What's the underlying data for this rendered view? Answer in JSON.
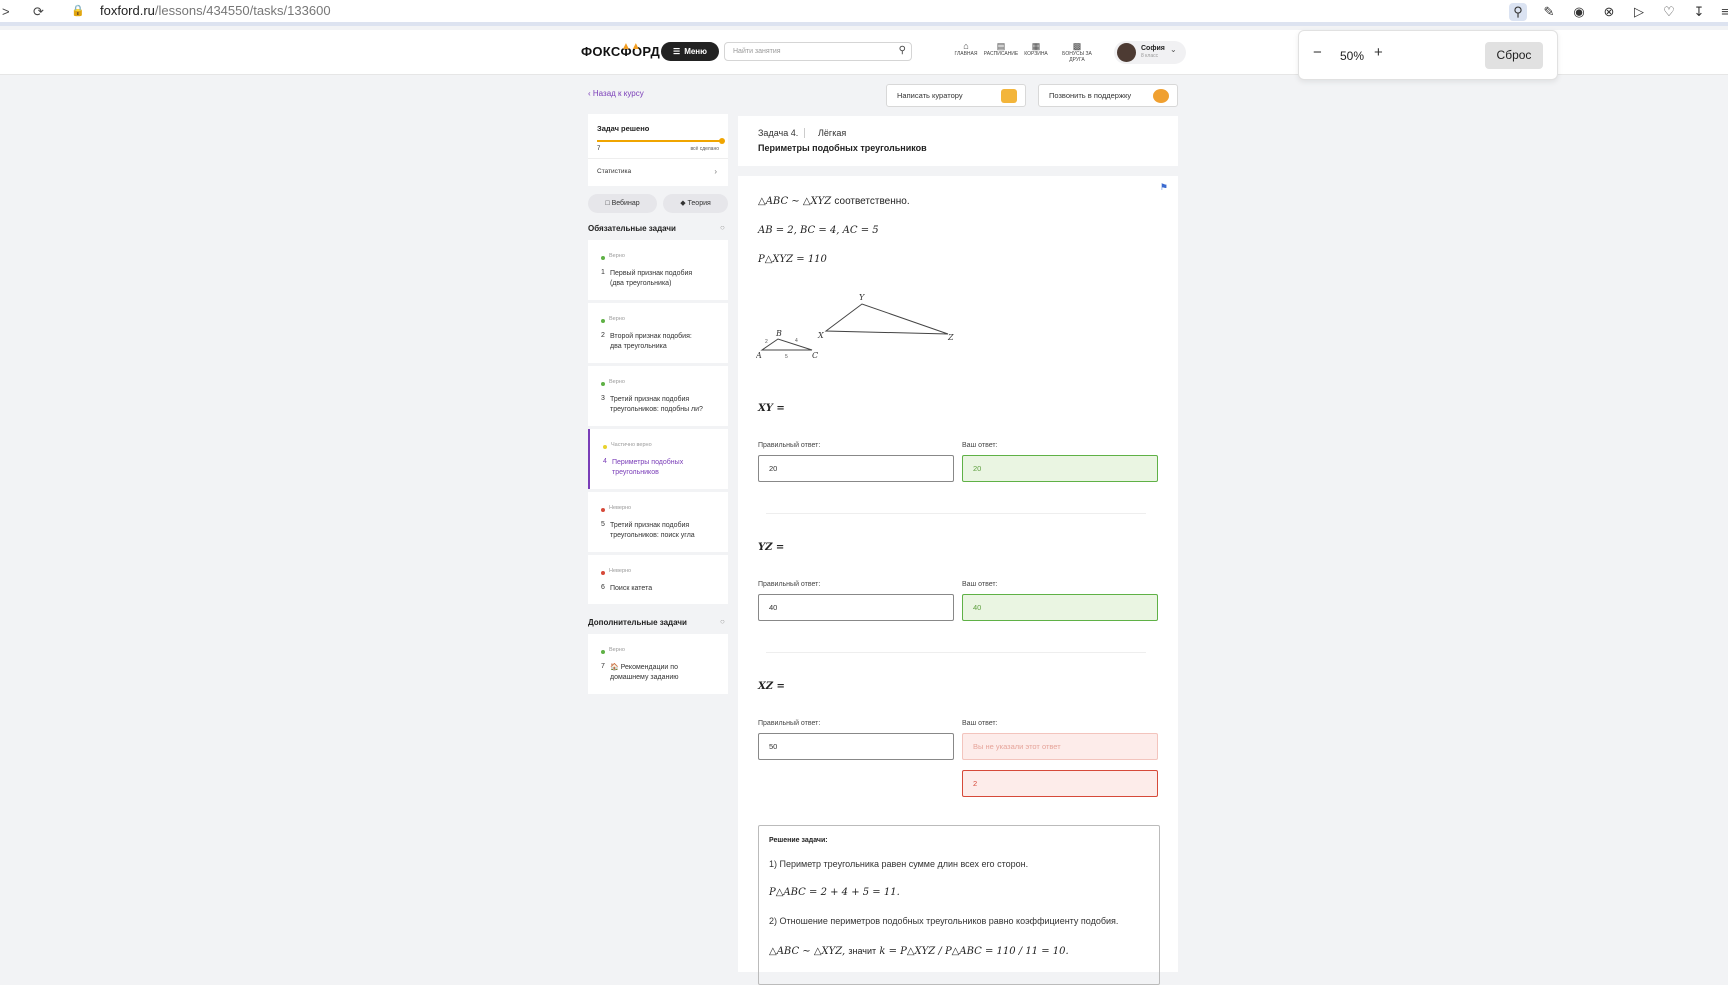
{
  "browser": {
    "url_domain": "foxford.ru",
    "url_path": "/lessons/434550/tasks/133600"
  },
  "site": {
    "logo": "ФОКСФОРД",
    "menu_label": "Меню",
    "search_placeholder": "Найти занятия",
    "nav": [
      "ГЛАВНАЯ",
      "РАСПИСАНИЕ",
      "КОРЗИНА",
      "БОНУСЫ ЗА ДРУГА"
    ],
    "user_name": "София",
    "user_grade": "8 класс"
  },
  "zoom": {
    "value": "50%",
    "reset_label": "Сброс"
  },
  "back_link": "Назад к курсу",
  "actions": {
    "write_curator": "Написать куратору",
    "call_support": "Позвонить в поддержку"
  },
  "progress": {
    "title": "Задач решено",
    "count": "7",
    "note": "всё сделано",
    "level": 1.0,
    "stats_label": "Статистика"
  },
  "pills": {
    "webinar": "Вебинар",
    "theory": "Теория"
  },
  "mandatory_header": "Обязательные задачи",
  "tasks": [
    {
      "status": "Верно",
      "num": "1",
      "line1": "Первый признак подобия",
      "line2": "(два треугольника)",
      "color": "#5fb146"
    },
    {
      "status": "Верно",
      "num": "2",
      "line1": "Второй признак подобия:",
      "line2": "два треугольника",
      "color": "#5fb146"
    },
    {
      "status": "Верно",
      "num": "3",
      "line1": "Третий признак подобия",
      "line2": "треугольников: подобны ли?",
      "color": "#5fb146"
    },
    {
      "status": "Частично верно",
      "num": "4",
      "line1": "Периметры подобных",
      "line2": "треугольников",
      "color": "#e8d22e"
    },
    {
      "status": "Неверно",
      "num": "5",
      "line1": "Третий признак подобия",
      "line2": "треугольников: поиск угла",
      "color": "#d64a3a"
    },
    {
      "status": "Неверно",
      "num": "6",
      "line1": "Поиск катета",
      "line2": "",
      "color": "#d64a3a"
    }
  ],
  "extra_header": "Дополнительные задачи",
  "extra_task": {
    "status": "Верно",
    "num": "7",
    "line1": "Рекомендации по",
    "line2": "домашнему заданию",
    "color": "#5fb146"
  },
  "task_header": {
    "label": "Задача 4.",
    "difficulty": "Лёгкая",
    "title": "Периметры подобных треугольников"
  },
  "problem": {
    "line1_math": "△ABC ∼ △XYZ",
    "line1_text": "соответственно.",
    "line2_math": "AB = 2, BC = 4, AC = 5",
    "line3_math": "P△XYZ = 110",
    "figure_labels": {
      "A": "A",
      "B": "B",
      "C": "C",
      "X": "X",
      "Y": "Y",
      "Z": "Z",
      "ab": "2",
      "bc": "4",
      "ac": "5"
    }
  },
  "questions": [
    {
      "label": "XY =",
      "correct_label": "Правильный ответ:",
      "your_label": "Ваш ответ:",
      "correct": "20",
      "yours": "20"
    },
    {
      "label": "YZ =",
      "correct_label": "Правильный ответ:",
      "your_label": "Ваш ответ:",
      "correct": "40",
      "yours": "40"
    },
    {
      "label": "XZ =",
      "correct_label": "Правильный ответ:",
      "your_label": "Ваш ответ:",
      "correct": "50",
      "missing": "Вы не указали этот ответ",
      "yours": "2"
    }
  ],
  "solution": {
    "title": "Решение задачи:",
    "step1": "1) Периметр треугольника равен сумме длин всех его сторон.",
    "step1_math": "P△ABC = 2 + 4 + 5 = 11.",
    "step2": "2) Отношение периметров подобных треугольников равно коэффициенту подобия.",
    "step2_math_a": "△ABC ∼ △XYZ,",
    "step2_text": "значит",
    "step2_math_b": "k = P△XYZ / P△ABC = 110 / 11 = 10."
  },
  "colors": {
    "accent": "#7a3db8",
    "ok": "#5fb146",
    "error": "#d64a3a",
    "progress": "#f0a500"
  }
}
